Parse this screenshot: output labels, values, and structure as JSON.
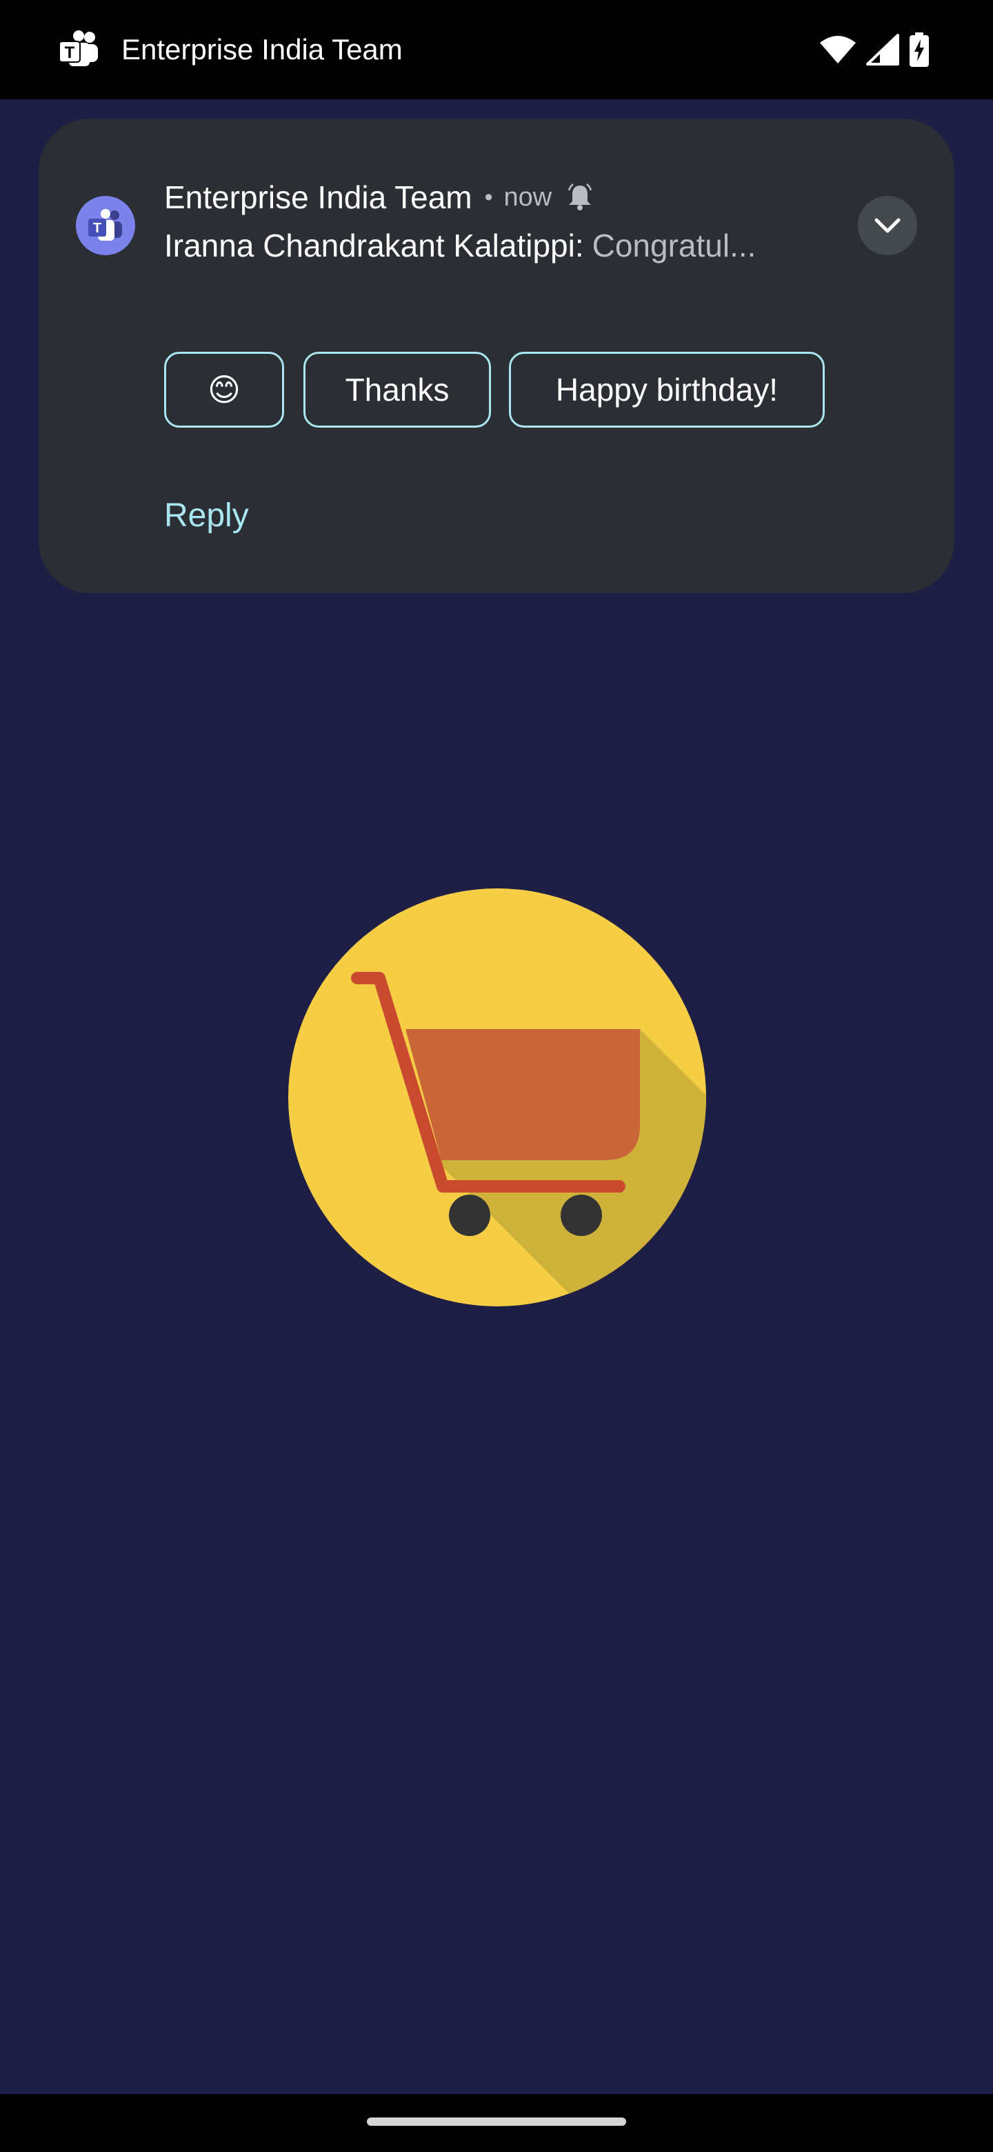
{
  "status_bar": {
    "app_icon": "microsoft-teams-icon",
    "title": "Enterprise India Team",
    "icons": [
      "wifi-icon",
      "cellular-signal-icon",
      "battery-charging-icon"
    ]
  },
  "notification": {
    "avatar_icon": "microsoft-teams-icon",
    "app_name": "Enterprise India Team",
    "separator": "•",
    "time": "now",
    "alert_icon": "bell-icon",
    "sender": "Iranna Chandrakant Kalatippi:",
    "preview": "Congratul...",
    "expand_icon": "chevron-down-icon",
    "smart_replies": [
      "😊",
      "Thanks",
      "Happy birthday!"
    ],
    "reply_label": "Reply",
    "colors": {
      "card": "#2b2f33",
      "accent": "#a9e6f2",
      "teams_purple": "#7b83eb"
    }
  },
  "background": {
    "color": "#1f1f45",
    "logo_icon": "shopping-cart-icon",
    "logo_colors": {
      "circle": "#f6ce46",
      "basket": "#c9663a",
      "frame": "#c94a2f",
      "wheels": "#333333"
    }
  },
  "nav_bar": {
    "handle": "home-gesture-handle"
  }
}
